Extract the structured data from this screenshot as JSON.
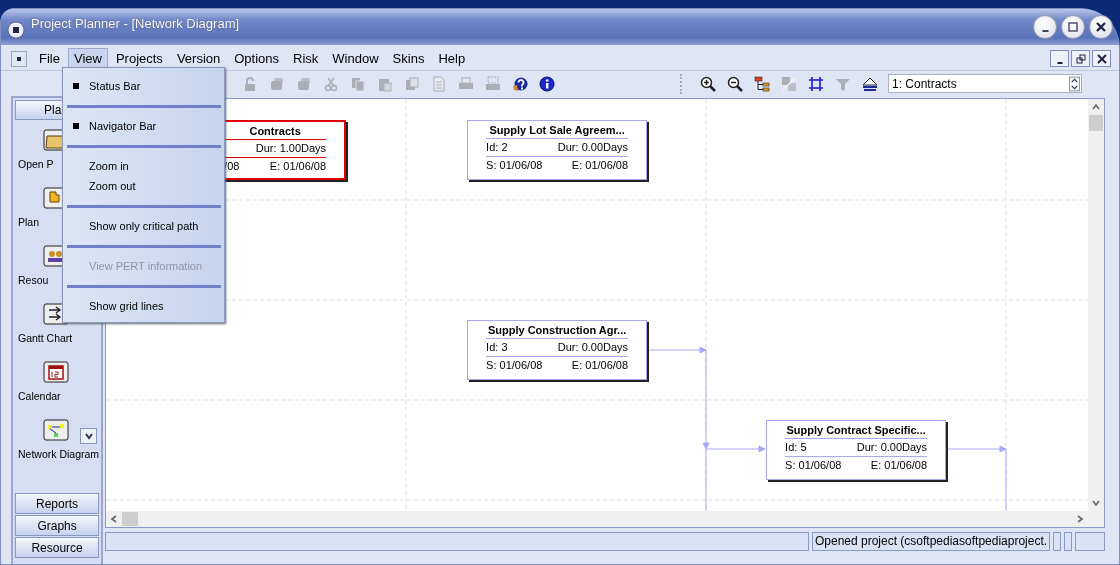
{
  "window": {
    "title": "Project Planner - [Network Diagram]"
  },
  "menu_bar": [
    {
      "label": "File",
      "selected": false
    },
    {
      "label": "View",
      "selected": true
    },
    {
      "label": "Projects",
      "selected": false
    },
    {
      "label": "Version",
      "selected": false
    },
    {
      "label": "Options",
      "selected": false
    },
    {
      "label": "Risk",
      "selected": false
    },
    {
      "label": "Window",
      "selected": false
    },
    {
      "label": "Skins",
      "selected": false
    },
    {
      "label": "Help",
      "selected": false
    }
  ],
  "view_menu": [
    {
      "kind": "item",
      "label": "Status Bar",
      "checked": true,
      "disabled": false
    },
    {
      "kind": "separator"
    },
    {
      "kind": "item",
      "label": "Navigator Bar",
      "checked": true,
      "disabled": false
    },
    {
      "kind": "separator"
    },
    {
      "kind": "item",
      "label": "Zoom in",
      "checked": false,
      "disabled": false
    },
    {
      "kind": "item",
      "label": "Zoom out",
      "checked": false,
      "disabled": false
    },
    {
      "kind": "separator"
    },
    {
      "kind": "item",
      "label": "Show only critical path",
      "checked": false,
      "disabled": false
    },
    {
      "kind": "separator"
    },
    {
      "kind": "item",
      "label": "View PERT information",
      "checked": false,
      "disabled": true
    },
    {
      "kind": "separator"
    },
    {
      "kind": "item",
      "label": "Show grid lines",
      "checked": false,
      "disabled": false
    }
  ],
  "toolbar": [
    {
      "kind": "lock",
      "disabled": true
    },
    {
      "kind": "blob",
      "disabled": true
    },
    {
      "kind": "blob",
      "disabled": true
    },
    {
      "kind": "cut",
      "disabled": true
    },
    {
      "kind": "copy",
      "disabled": true
    },
    {
      "kind": "paste",
      "disabled": true
    },
    {
      "kind": "window",
      "disabled": true
    },
    {
      "kind": "document",
      "disabled": true
    },
    {
      "kind": "printer",
      "disabled": true
    },
    {
      "kind": "preview",
      "disabled": true
    },
    {
      "kind": "help",
      "disabled": false
    },
    {
      "kind": "info",
      "disabled": false
    },
    {
      "kind": "sep"
    },
    {
      "kind": "zoomin",
      "disabled": false
    },
    {
      "kind": "zoomout",
      "disabled": false
    },
    {
      "kind": "tree",
      "disabled": false
    },
    {
      "kind": "swap",
      "disabled": true
    },
    {
      "kind": "grid",
      "disabled": false
    },
    {
      "kind": "down",
      "disabled": true
    },
    {
      "kind": "up",
      "disabled": false
    }
  ],
  "task_select": {
    "value": "1:  Contracts"
  },
  "navigator": {
    "header": "Pla",
    "items": [
      {
        "label": "Open P"
      },
      {
        "label": "Plan"
      },
      {
        "label": "Resou"
      },
      {
        "label": "Gantt Chart"
      },
      {
        "label": "Calendar"
      },
      {
        "label": "Network Diagram"
      }
    ],
    "sections": [
      "Reports",
      "Graphs",
      "Resource"
    ]
  },
  "nodes": [
    {
      "title": "Contracts",
      "dur": "Dur: 1.00Days",
      "start": "/08",
      "end": "E: 01/06/08",
      "critical": true
    },
    {
      "title": "Supply Lot Sale Agreem...",
      "id": "Id: 2",
      "dur": "Dur: 0.00Days",
      "start": "S: 01/06/08",
      "end": "E: 01/06/08",
      "critical": false
    },
    {
      "title": "Supply Construction Agr...",
      "id": "Id: 3",
      "dur": "Dur: 0.00Days",
      "start": "S: 01/06/08",
      "end": "E: 01/06/08",
      "critical": false
    },
    {
      "title": "Supply Contract Specific...",
      "id": "Id: 5",
      "dur": "Dur: 0.00Days",
      "start": "S: 01/06/08",
      "end": "E: 01/06/08",
      "critical": false
    }
  ],
  "status_bar": {
    "message": "Opened project (csoftpediasoftpediaproject."
  }
}
